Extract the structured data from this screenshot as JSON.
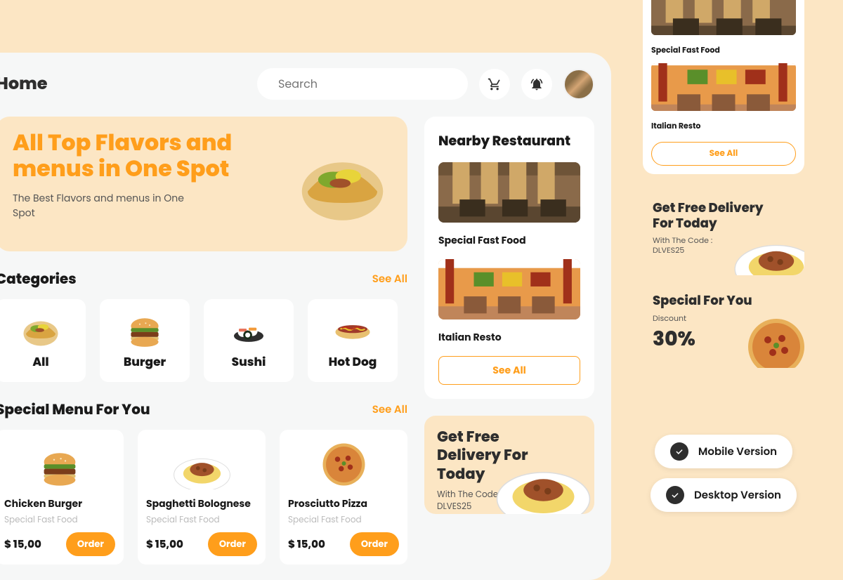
{
  "header": {
    "title": "Home",
    "search_placeholder": "Search"
  },
  "hero": {
    "title": "All Top Flavors and menus in One Spot",
    "subtitle": "The Best Flavors and menus in One Spot"
  },
  "categories": {
    "title": "Categories",
    "see_all": "See All",
    "items": [
      {
        "label": "All"
      },
      {
        "label": "Burger"
      },
      {
        "label": "Sushi"
      },
      {
        "label": "Hot Dog"
      }
    ]
  },
  "special_menu": {
    "title": "Special Menu For You",
    "see_all": "See All",
    "items": [
      {
        "name": "Chicken Burger",
        "sub": "Special Fast Food",
        "price": "$ 15,00",
        "order": "Order"
      },
      {
        "name": "Spaghetti Bolognese",
        "sub": "Special Fast Food",
        "price": "$ 15,00",
        "order": "Order"
      },
      {
        "name": "Prosciutto Pizza",
        "sub": "Special Fast Food",
        "price": "$ 15,00",
        "order": "Order"
      }
    ]
  },
  "nearby": {
    "title": "Nearby Restaurant",
    "see_all": "See All",
    "items": [
      {
        "name": "Special Fast Food"
      },
      {
        "name": "Italian Resto"
      }
    ]
  },
  "promo_delivery": {
    "title": "Get Free Delivery For Today",
    "sub_line1": "With The Code :",
    "sub_line2": "DLVES25"
  },
  "promo_special": {
    "title": "Special For You",
    "label": "Discount",
    "value": "30%"
  },
  "mobile_preview": {
    "items": [
      {
        "name": "Special Fast Food"
      },
      {
        "name": "Italian Resto"
      }
    ],
    "see_all": "See All"
  },
  "versions": {
    "mobile": "Mobile Version",
    "desktop": "Desktop Version"
  }
}
